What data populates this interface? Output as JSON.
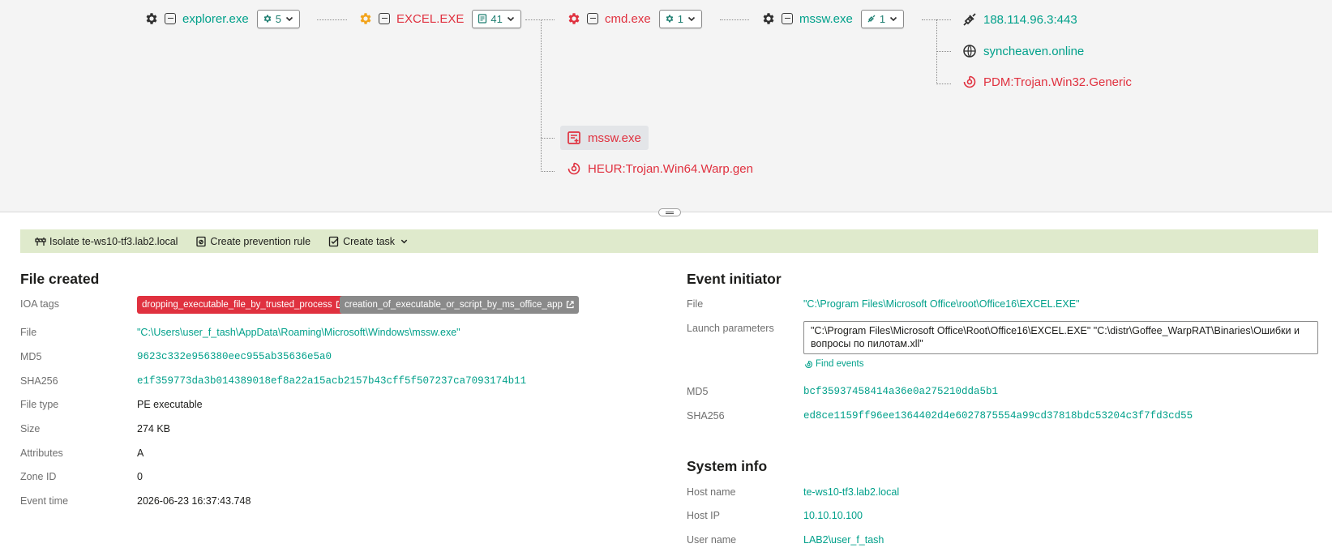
{
  "tree": {
    "nodes": [
      {
        "name": "explorer.exe",
        "count": "5",
        "count_icon": "gear-icon"
      },
      {
        "name": "EXCEL.EXE",
        "count": "41",
        "count_icon": "file-icon"
      },
      {
        "name": "cmd.exe",
        "count": "1",
        "count_icon": "gear-icon"
      },
      {
        "name": "mssw.exe",
        "count": "1",
        "count_icon": "network-icon"
      }
    ],
    "mssw_children": [
      {
        "label": "188.114.96.3:443",
        "icon": "network-plug-icon"
      },
      {
        "label": "syncheaven.online",
        "icon": "globe-icon"
      },
      {
        "label": "PDM:Trojan.Win32.Generic",
        "icon": "detection-icon"
      }
    ],
    "excel_children": [
      {
        "label": "mssw.exe",
        "icon": "file-created-icon"
      },
      {
        "label": "HEUR:Trojan.Win64.Warp.gen",
        "icon": "detection-icon"
      }
    ]
  },
  "toolbar": {
    "isolate_label": "Isolate te-ws10-tf3.lab2.local",
    "prevention_label": "Create prevention rule",
    "task_label": "Create task"
  },
  "file_created": {
    "title": "File created",
    "labels": {
      "ioa_tags": "IOA tags",
      "file": "File",
      "md5": "MD5",
      "sha256": "SHA256",
      "file_type": "File type",
      "size": "Size",
      "attributes": "Attributes",
      "zone_id": "Zone ID",
      "event_time": "Event time"
    },
    "tags": [
      "dropping_executable_file_by_trusted_process",
      "creation_of_executable_or_script_by_ms_office_app"
    ],
    "file": "\"C:\\Users\\user_f_tash\\AppData\\Roaming\\Microsoft\\Windows\\mssw.exe\"",
    "md5": "9623c332e956380eec955ab35636e5a0",
    "sha256": "e1f359773da3b014389018ef8a22a15acb2157b43cff5f507237ca7093174b11",
    "file_type": "PE executable",
    "size": "274 KB",
    "attributes": "A",
    "zone_id": "0",
    "event_time": "2026-06-23 16:37:43.748"
  },
  "event_initiator": {
    "title": "Event initiator",
    "labels": {
      "file": "File",
      "launch": "Launch parameters",
      "md5": "MD5",
      "sha256": "SHA256"
    },
    "file": "\"C:\\Program Files\\Microsoft Office\\root\\Office16\\EXCEL.EXE\"",
    "launch_params": "\"C:\\Program Files\\Microsoft Office\\Root\\Office16\\EXCEL.EXE\" \"C:\\distr\\Goffee_WarpRAT\\Binaries\\Ошибки и вопросы по пилотам.xll\"",
    "find_events": "Find events",
    "md5": "bcf35937458414a36e0a275210dda5b1",
    "sha256": "ed8ce1159ff96ee1364402d4e6027875554a99cd37818bdc53204c3f7fd3cd55"
  },
  "system_info": {
    "title": "System info",
    "labels": {
      "host_name": "Host name",
      "host_ip": "Host IP",
      "user_name": "User name"
    },
    "host_name": "te-ws10-tf3.lab2.local",
    "host_ip": "10.10.10.100",
    "user_name": "LAB2\\user_f_tash"
  },
  "colors": {
    "teal": "#00a08a",
    "red": "#e0313f",
    "orange": "#f2a31b",
    "toolbar_bg": "#dfeacc"
  }
}
